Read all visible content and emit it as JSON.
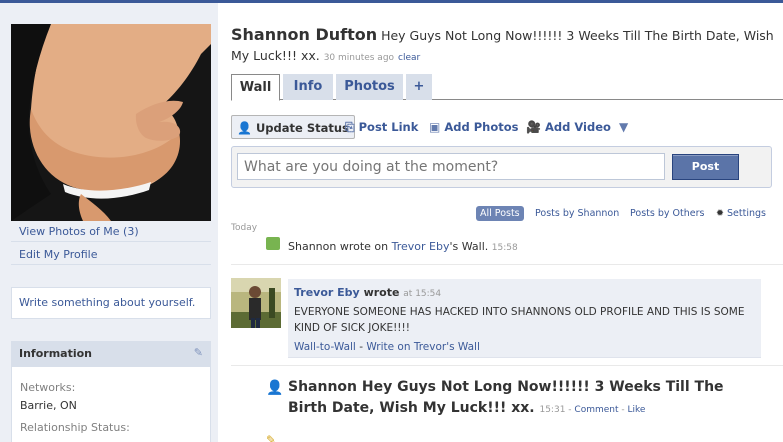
{
  "profile": {
    "name": "Shannon Dufton",
    "status_text": "Hey Guys Not Long Now!!!!!! 3 Weeks Till The Birth Date, Wish My Luck!!! xx.",
    "status_time": "30 minutes ago",
    "clear_label": "clear"
  },
  "sidebar": {
    "view_photos": "View Photos of Me (3)",
    "edit_profile": "Edit My Profile",
    "write_about": "Write something about yourself.",
    "info_heading": "Information",
    "networks_label": "Networks:",
    "networks_value": "Barrie, ON",
    "relationship_label": "Relationship Status:"
  },
  "tabs": [
    {
      "label": "Wall"
    },
    {
      "label": "Info"
    },
    {
      "label": "Photos"
    },
    {
      "label": "+"
    }
  ],
  "composer": {
    "update_status": "Update Status",
    "post_link": "Post Link",
    "add_photos": "Add Photos",
    "add_video": "Add Video",
    "placeholder": "What are you doing at the moment?",
    "post_button": "Post"
  },
  "filters": {
    "all_posts": "All Posts",
    "by_shannon": "Posts by Shannon",
    "by_others": "Posts by Others",
    "settings": "Settings"
  },
  "feed": {
    "day_label": "Today",
    "mini_story_prefix": "Shannon wrote on ",
    "mini_story_link": "Trevor Eby",
    "mini_story_suffix": "'s Wall.",
    "mini_story_time": "15:58",
    "wall_post": {
      "author": "Trevor Eby",
      "wrote": "wrote",
      "time": "at 15:54",
      "message": "EVERYONE SOMEONE HAS HACKED INTO SHANNONS OLD PROFILE AND THIS IS SOME KIND OF SICK JOKE!!!!",
      "wall_to_wall": "Wall-to-Wall",
      "dash": "-",
      "write_on": "Write on Trevor's Wall"
    },
    "status_story": {
      "text": "Shannon Hey Guys Not Long Now!!!!!! 3 Weeks Till The Birth Date, Wish My Luck!!! xx.",
      "time": "15:31",
      "comment": "Comment",
      "like": "Like"
    }
  },
  "colors": {
    "brand": "#3b5998",
    "sidebar_bg": "#eceff5",
    "post_button": "#5b74a8",
    "filter_active": "#6d84b4"
  },
  "icons": {
    "update_status": "person-icon",
    "post_link": "link-icon",
    "add_photos": "photo-icon",
    "add_video": "video-camera-icon",
    "dropdown": "chevron-down-icon",
    "settings": "gear-icon",
    "info_edit": "pencil-icon",
    "wall_post": "wall-post-icon",
    "status": "person-icon"
  }
}
